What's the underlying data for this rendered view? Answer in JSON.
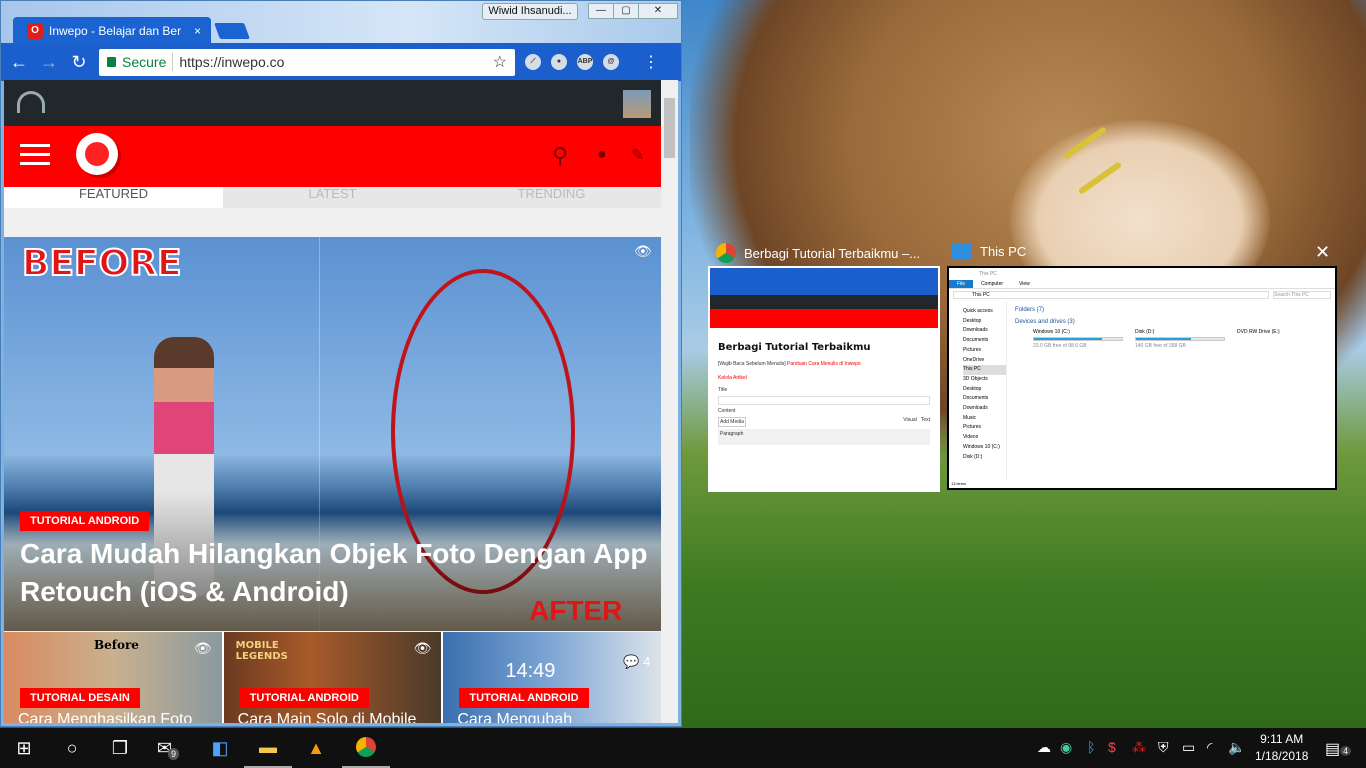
{
  "browser": {
    "tab_title": "Inwepo - Belajar dan Ber",
    "tab_close": "×",
    "user_name": "Wiwid Ihsanudi...",
    "window_buttons": {
      "minimize": "—",
      "maximize": "▢",
      "close": "✕"
    },
    "secure_label": "Secure",
    "url": "https://inwepo.co",
    "extensions": [
      "ABP"
    ]
  },
  "site": {
    "tabs": [
      "FEATURED",
      "LATEST",
      "TRENDING"
    ],
    "hero": {
      "category": "TUTORIAL ANDROID",
      "title": "Cara Mudah Hilangkan Objek Foto Dengan App Retouch (iOS & Android)",
      "before_label": "BEFORE",
      "after_label": "AFTER"
    },
    "cards": [
      {
        "category": "TUTORIAL DESAIN",
        "title": "Cara Menghasilkan Foto",
        "image_text": "Before"
      },
      {
        "category": "TUTORIAL ANDROID",
        "title": "Cara Main Solo di Mobile",
        "image_text": "MOBILE LEGENDS"
      },
      {
        "category": "TUTORIAL ANDROID",
        "title": "Cara Mengubah",
        "image_text": "14:49",
        "comments": "4"
      }
    ],
    "brand_color": "#ff0000"
  },
  "snap_assist": {
    "windows": [
      {
        "title": "Berbagi Tutorial Terbaikmu –...",
        "page_heading": "Berbagi Tutorial Terbaikmu",
        "note": "[Wajib Baca Sebelum Menulis]",
        "note_link": "Panduan Cara Menulis di Inwepo",
        "link2": "Kelola Artikel",
        "title_label": "Title",
        "content_label": "Content",
        "add_media": "Add Media",
        "visual": "Visual",
        "text": "Text",
        "paragraph": "Paragraph"
      },
      {
        "title": "This PC",
        "ribbon": [
          "File",
          "Computer",
          "View"
        ],
        "address": "This PC",
        "search": "Search This PC",
        "folders": "Folders (7)",
        "devices": "Devices and drives (3)",
        "nav": [
          "Quick access",
          "Desktop",
          "Downloads",
          "Documents",
          "Pictures",
          "OneDrive",
          "This PC",
          "3D Objects",
          "Desktop",
          "Documents",
          "Downloads",
          "Music",
          "Pictures",
          "Videos",
          "Windows 10 (C:)",
          "Disk (D:)"
        ],
        "drives": [
          {
            "name": "Windows 10 (C:)",
            "free": "23.0 GB free of 98.6 GB",
            "used_fraction": 0.77
          },
          {
            "name": "Disk (D:)",
            "free": "140 GB free of 368 GB",
            "used_fraction": 0.62
          },
          {
            "name": "DVD RW Drive (E:)",
            "free": "",
            "used_fraction": 0
          }
        ],
        "status": "13 items"
      }
    ],
    "close": "✕"
  },
  "taskbar": {
    "mail_badge": "9",
    "time": "9:11 AM",
    "date": "1/18/2018",
    "notifications": "4"
  }
}
